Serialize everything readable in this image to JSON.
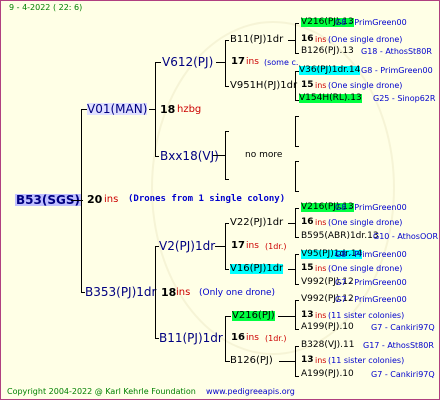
{
  "date": "9 - 4-2022 ( 22: 6)",
  "footer": {
    "copyright": "Copyright 2004-2022 @ Karl Kehrle Foundation",
    "url": "www.pedigreeapis.org"
  },
  "root": {
    "label": "B53(SGS)",
    "count": "20",
    "ins": "ins",
    "note": "(Drones from 1 single colony)"
  },
  "sire": {
    "label": "V01(MAN)",
    "count": "18",
    "code": "hzbg"
  },
  "dam": {
    "label": "B353(PJ)1dr",
    "count": "18",
    "ins": "ins",
    "note": "(Only one drone)"
  },
  "ss": {
    "label": "V612(PJ)",
    "count": "17",
    "ins": "ins",
    "note": "(some c."
  },
  "sd": {
    "label": "Bxx18(VJ)",
    "note": "no more"
  },
  "ds": {
    "label": "V2(PJ)1dr",
    "count": "17",
    "ins": "ins",
    "note": "(1dr.)"
  },
  "dd": {
    "label": "B11(PJ)1dr",
    "count": "16",
    "ins": "ins",
    "note": "(1dr.)"
  },
  "sss": {
    "label": "B11(PJ)1dr",
    "count": "16",
    "ins": "ins",
    "note": "(One single drone)"
  },
  "ssd": {
    "label": "V951H(PJ)1dr",
    "count": "15",
    "ins": "ins",
    "note": "(One single drone)"
  },
  "dss": {
    "label": "V22(PJ)1dr",
    "count": "16",
    "ins": "ins",
    "note": "(One single drone)"
  },
  "dsd": {
    "label": "V16(PJ)1dr",
    "count": "15",
    "ins": "ins",
    "note": "(One single drone)"
  },
  "dds": {
    "label": "V216(PJ)",
    "count": "13",
    "ins": "ins",
    "note": "(11 sister colonies)"
  },
  "ddd": {
    "label": "B126(PJ)",
    "count": "13",
    "ins": "ins",
    "note": "(11 sister colonies)"
  },
  "g4": [
    {
      "label": "V216(PJ).13",
      "code": "G8 - PrimGreen00",
      "hl": "green"
    },
    {
      "label": "B126(PJ).13",
      "code": "G18 - AthosSt80R",
      "hl": ""
    },
    {
      "label": "V36(PJ)1dr.14",
      "code": "G8 - PrimGreen00",
      "hl": "cyan"
    },
    {
      "label": "V154H(RL).13",
      "code": "G25 - Sinop62R",
      "hl": "green"
    },
    {
      "label": "V216(PJ).13",
      "code": "G8 - PrimGreen00",
      "hl": "green"
    },
    {
      "label": "B595(ABR)1dr.13",
      "code": "G10 - AthosOOR",
      "hl": ""
    },
    {
      "label": "V95(PJ)1dr.14",
      "code": "G8 - PrimGreen00",
      "hl": "cyan"
    },
    {
      "label": "V992(PJ).12",
      "code": "G7 - PrimGreen00",
      "hl": ""
    },
    {
      "label": "V992(PJ).12",
      "code": "G7 - PrimGreen00",
      "hl": ""
    },
    {
      "label": "A199(PJ).10",
      "code": "G7 - Cankiri97Q",
      "hl": ""
    },
    {
      "label": "B328(VJ).11",
      "code": "G17 - AthosSt80R",
      "hl": ""
    },
    {
      "label": "A199(PJ).10",
      "code": "G7 - Cankiri97Q",
      "hl": ""
    }
  ]
}
